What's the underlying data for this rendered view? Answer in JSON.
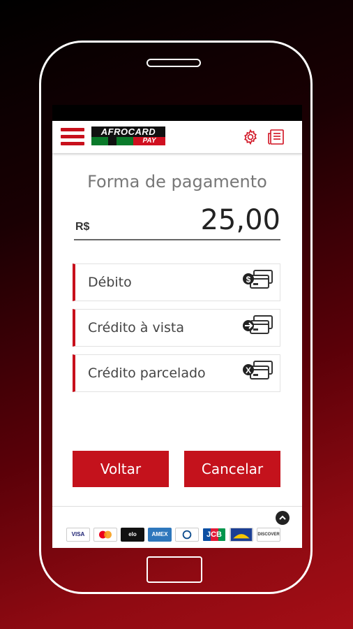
{
  "header": {
    "logo_text": "AFROCARD",
    "logo_pay": "PAY",
    "menu_icon": "hamburger-icon",
    "settings_icon": "gear-icon",
    "receipt_icon": "receipt-icon"
  },
  "payment": {
    "title": "Forma de pagamento",
    "currency": "R$",
    "amount": "25,00"
  },
  "options": [
    {
      "label": "Débito",
      "icon": "card-dollar-icon"
    },
    {
      "label": "Crédito à vista",
      "icon": "card-arrow-icon"
    },
    {
      "label": "Crédito parcelado",
      "icon": "card-x-icon"
    }
  ],
  "buttons": {
    "back_label": "Voltar",
    "cancel_label": "Cancelar"
  },
  "footer": {
    "cards": [
      "VISA",
      "mastercard",
      "elo",
      "AMEX",
      "Diners",
      "JCB",
      "Hipercard",
      "DISCOVER"
    ]
  },
  "colors": {
    "accent": "#c4121c",
    "bg_dark": "#000000",
    "bg_red": "#a50e16"
  }
}
